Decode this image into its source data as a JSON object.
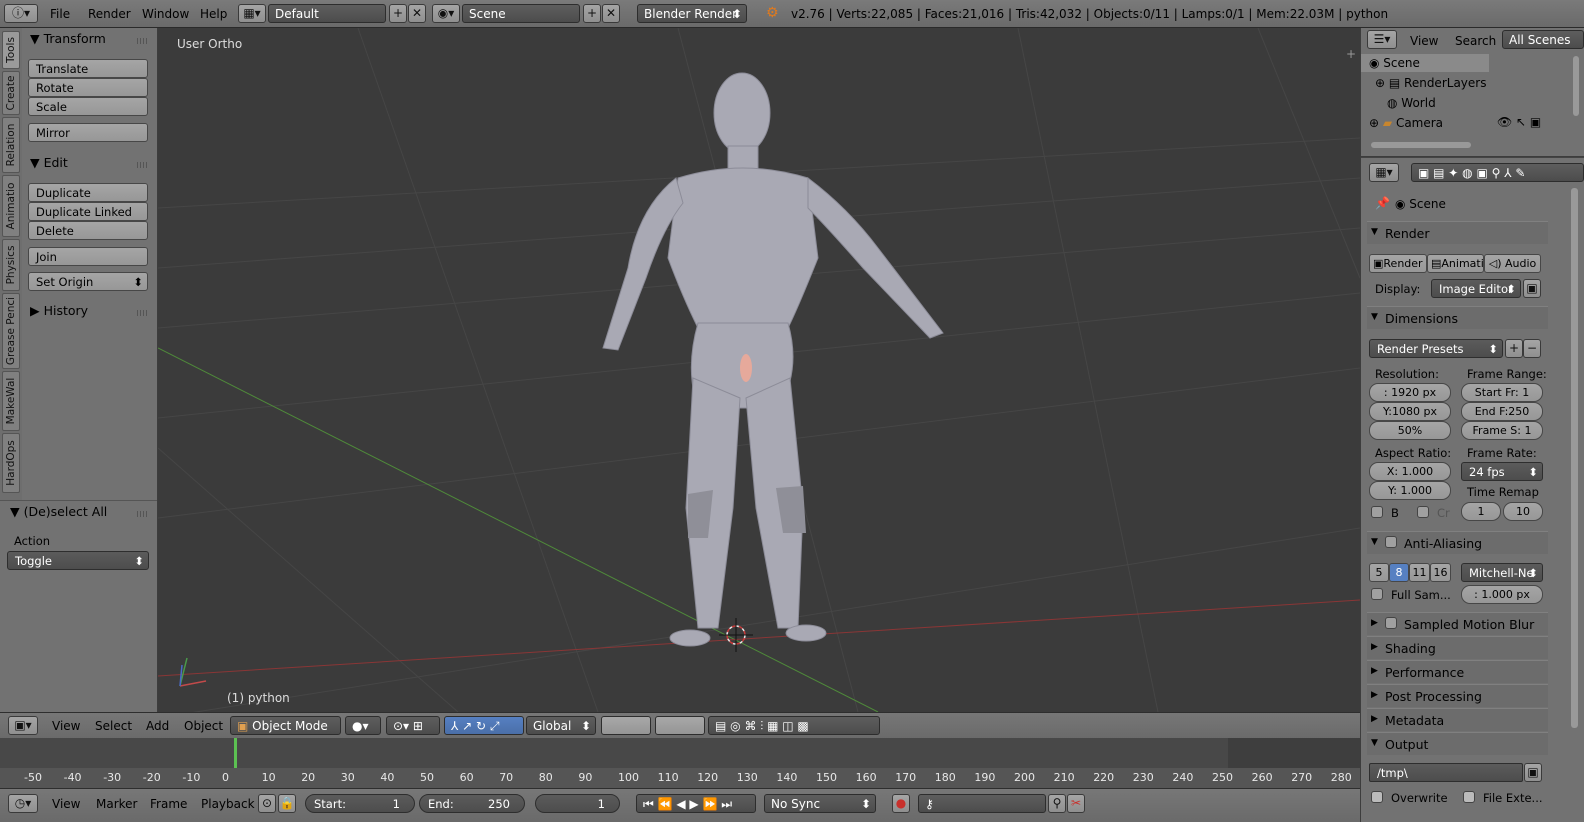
{
  "topbar": {
    "menus": [
      "File",
      "Render",
      "Window",
      "Help"
    ],
    "layout": "Default",
    "scene": "Scene",
    "engine": "Blender Render",
    "stats": "v2.76 | Verts:22,085 | Faces:21,016 | Tris:42,032 | Objects:0/11 | Lamps:0/1 | Mem:22.03M | python"
  },
  "tooltabs": [
    "Tools",
    "Create",
    "Relation",
    "Animatio",
    "Physics",
    "Grease Penci",
    "MakeWal",
    "HardOps"
  ],
  "toolpanel": {
    "transform_title": "Transform",
    "transform_buttons": [
      "Translate",
      "Rotate",
      "Scale"
    ],
    "mirror": "Mirror",
    "edit_title": "Edit",
    "edit_buttons": [
      "Duplicate",
      "Duplicate Linked",
      "Delete"
    ],
    "join": "Join",
    "set_origin": "Set Origin",
    "history_title": "History"
  },
  "operator": {
    "title": "(De)select All",
    "action_label": "Action",
    "action_value": "Toggle"
  },
  "viewport": {
    "view_name": "User Ortho",
    "object_label": "(1) python"
  },
  "view3d_header": {
    "menus": [
      "View",
      "Select",
      "Add",
      "Object"
    ],
    "mode": "Object Mode",
    "orientation": "Global"
  },
  "timeline": {
    "ticks": [
      "-50",
      "-40",
      "-30",
      "-20",
      "-10",
      "0",
      "10",
      "20",
      "30",
      "40",
      "50",
      "60",
      "70",
      "80",
      "90",
      "100",
      "110",
      "120",
      "130",
      "140",
      "150",
      "160",
      "170",
      "180",
      "190",
      "200",
      "210",
      "220",
      "230",
      "240",
      "250",
      "260",
      "270",
      "280"
    ],
    "menus": [
      "View",
      "Marker",
      "Frame",
      "Playback"
    ],
    "start_label": "Start:",
    "start_value": "1",
    "end_label": "End:",
    "end_value": "250",
    "current": "1",
    "sync": "No Sync"
  },
  "outliner": {
    "menus": [
      "View",
      "Search"
    ],
    "filter": "All Scenes",
    "items": [
      "Scene",
      "RenderLayers",
      "World",
      "Camera"
    ]
  },
  "properties": {
    "context": "Scene",
    "render_title": "Render",
    "render_buttons": [
      "Render",
      "Animati",
      "Audio"
    ],
    "display_label": "Display:",
    "display_value": "Image Editor",
    "dimensions_title": "Dimensions",
    "presets": "Render Presets",
    "resolution_label": "Resolution:",
    "res_x": ": 1920 px",
    "res_y": "Y:1080 px",
    "res_pct": "50%",
    "frame_range_label": "Frame Range:",
    "start_fr": "Start Fr: 1",
    "end_fr": "End F:250",
    "frame_step": "Frame S: 1",
    "aspect_label": "Aspect Ratio:",
    "aspect_x": "X:   1.000",
    "aspect_y": "Y:   1.000",
    "frame_rate_label": "Frame Rate:",
    "fps": "24 fps",
    "time_remap_label": "Time Remap",
    "border_label": "B",
    "crop_label": "Cr",
    "remap_old": "1",
    "remap_new": "10",
    "aa_title": "Anti-Aliasing",
    "aa_samples": [
      "5",
      "8",
      "11",
      "16"
    ],
    "aa_filter": "Mitchell-Ne",
    "full_sample": "Full Sam...",
    "filter_size": ": 1.000 px",
    "motion_blur_title": "Sampled Motion Blur",
    "collapsed": [
      "Shading",
      "Performance",
      "Post Processing",
      "Metadata"
    ],
    "output_title": "Output",
    "output_path": "/tmp\\",
    "overwrite": "Overwrite",
    "file_ext": "File Exte..."
  },
  "colors": {
    "viewport_bg": "#3b3b3b",
    "panel_bg": "#727272",
    "highlight": "#5680c2",
    "x_axis": "#8a3636",
    "y_axis": "#4f8a3a"
  }
}
